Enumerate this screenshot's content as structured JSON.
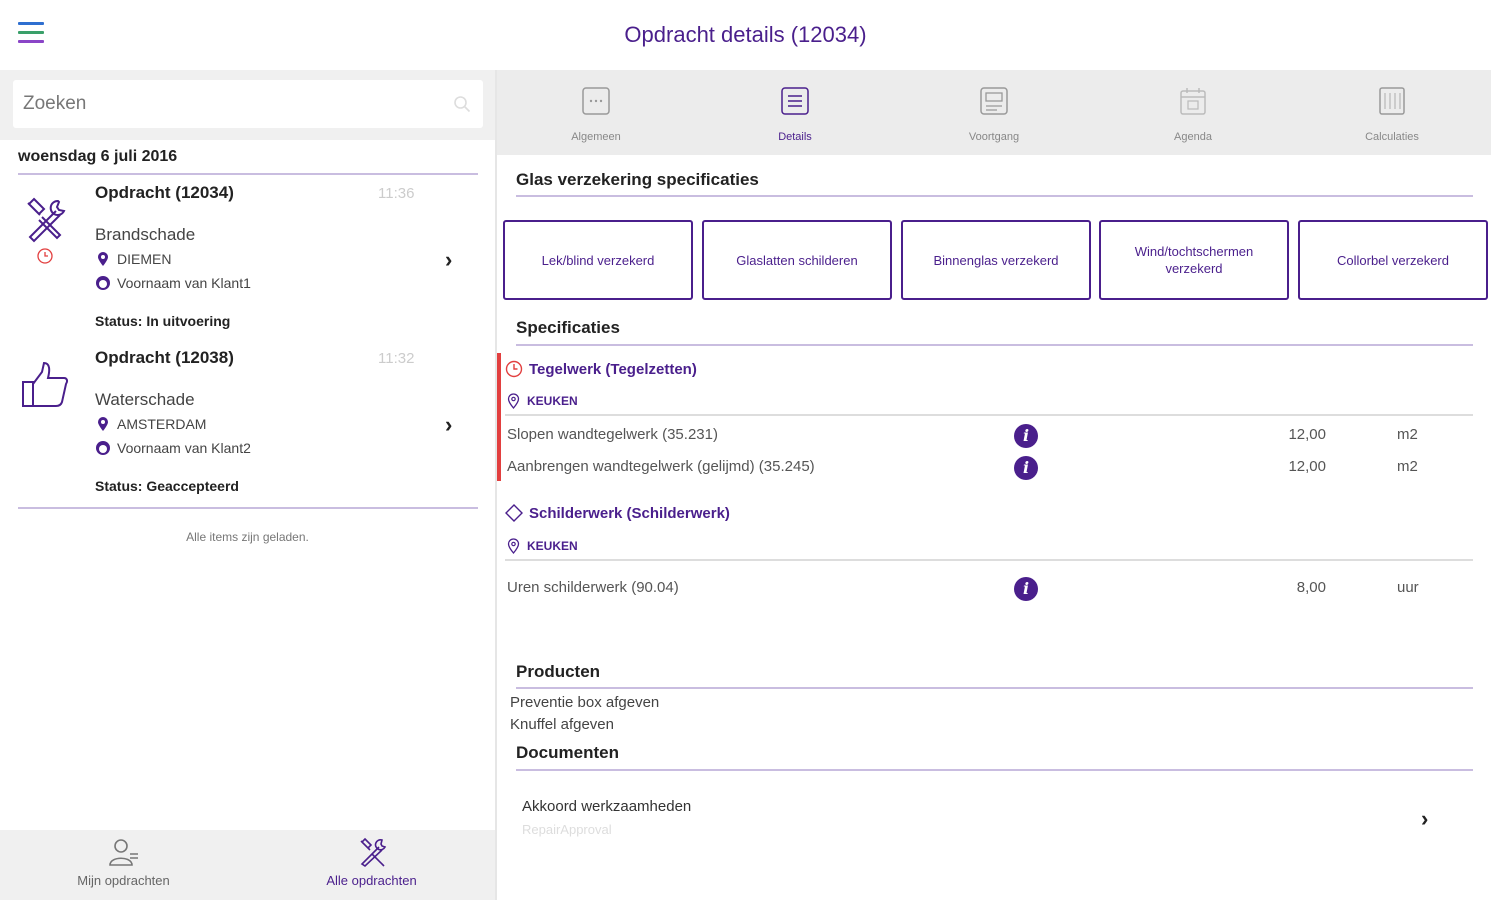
{
  "header": {
    "title": "Opdracht details (12034)"
  },
  "colors": {
    "brand": "#4a1f8c",
    "accent_line": "#c9bde0",
    "alert": "#e23f3f"
  },
  "search": {
    "placeholder": "Zoeken"
  },
  "list": {
    "date": "woensdag 6 juli 2016",
    "orders": [
      {
        "title": "Opdracht (12034)",
        "time": "11:36",
        "type": "Brandschade",
        "city": "DIEMEN",
        "client": "Voornaam van Klant1",
        "status": "Status: In uitvoering",
        "icon": "tools-icon"
      },
      {
        "title": "Opdracht (12038)",
        "time": "11:32",
        "type": "Waterschade",
        "city": "AMSTERDAM",
        "client": "Voornaam van Klant2",
        "status": "Status: Geaccepteerd",
        "icon": "thumbs-up-icon"
      }
    ],
    "loaded_note": "Alle items zijn geladen."
  },
  "bottom_nav": [
    {
      "label": "Mijn opdrachten",
      "icon": "person-icon"
    },
    {
      "label": "Alle opdrachten",
      "icon": "tools-group-icon"
    }
  ],
  "tabs": [
    {
      "label": "Algemeen",
      "icon": "chat-icon"
    },
    {
      "label": "Details",
      "icon": "list-icon",
      "active": true
    },
    {
      "label": "Voortgang",
      "icon": "progress-icon"
    },
    {
      "label": "Agenda",
      "icon": "calendar-icon"
    },
    {
      "label": "Calculaties",
      "icon": "calculator-icon"
    }
  ],
  "glass": {
    "title": "Glas verzekering specificaties",
    "buttons": [
      "Lek/blind verzekerd",
      "Glaslatten schilderen",
      "Binnenglas verzekerd",
      "Wind/tochtschermen verzekerd",
      "Collorbel verzekerd"
    ]
  },
  "specs": {
    "title": "Specificaties",
    "groups": [
      {
        "name": "Tegelwerk (Tegelzetten)",
        "location": "KEUKEN",
        "icon": "clock-icon",
        "rows": [
          {
            "desc": "Slopen wandtegelwerk (35.231)",
            "qty": "12,00",
            "unit": "m2"
          },
          {
            "desc": "Aanbrengen wandtegelwerk (gelijmd) (35.245)",
            "qty": "12,00",
            "unit": "m2"
          }
        ]
      },
      {
        "name": "Schilderwerk (Schilderwerk)",
        "location": "KEUKEN",
        "icon": "diamond-icon",
        "rows": [
          {
            "desc": "Uren schilderwerk (90.04)",
            "qty": "8,00",
            "unit": "uur"
          }
        ]
      }
    ]
  },
  "products": {
    "title": "Producten",
    "items": [
      "Preventie box afgeven",
      "Knuffel afgeven"
    ]
  },
  "documents": {
    "title": "Documenten",
    "items": [
      {
        "title": "Akkoord werkzaamheden",
        "subtitle": "RepairApproval"
      }
    ]
  }
}
